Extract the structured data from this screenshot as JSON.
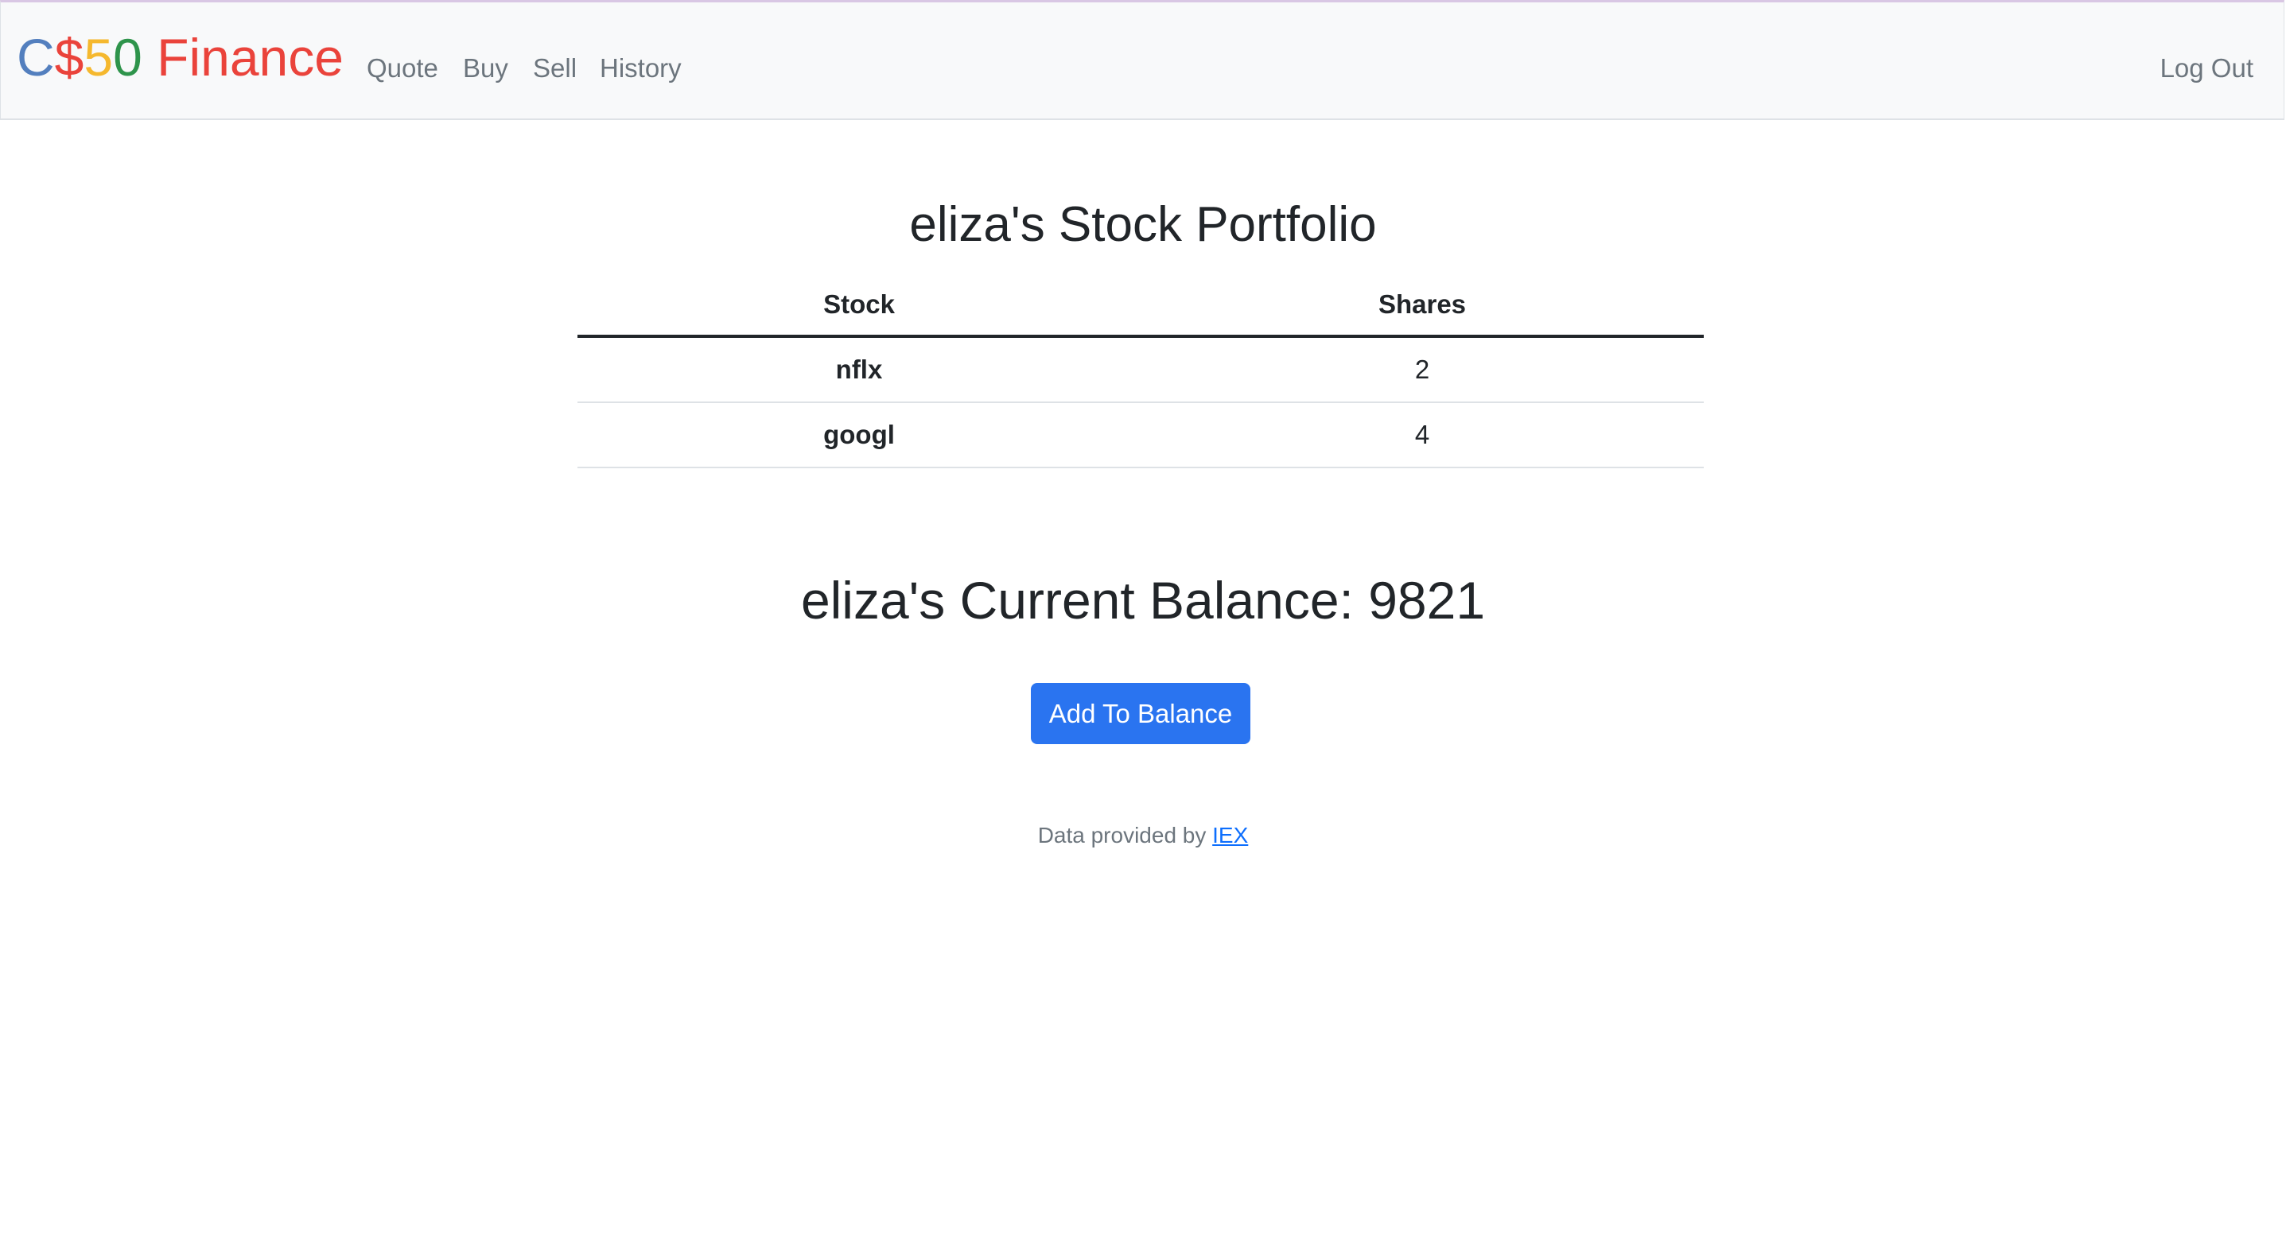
{
  "navbar": {
    "brand": {
      "part1": "C",
      "part2": "$",
      "part3": "5",
      "part4": "0",
      "part5": " Finance"
    },
    "links": {
      "quote": "Quote",
      "buy": "Buy",
      "sell": "Sell",
      "history": "History",
      "logout": "Log Out"
    }
  },
  "main": {
    "title": "eliza's Stock Portfolio",
    "table": {
      "headers": [
        "Stock",
        "Shares"
      ],
      "rows": [
        {
          "stock": "nflx",
          "shares": "2"
        },
        {
          "stock": "googl",
          "shares": "4"
        }
      ]
    },
    "balance_heading": "eliza's Current Balance: 9821",
    "add_balance_button": "Add To Balance"
  },
  "footer": {
    "prefix": "Data provided by ",
    "link": "IEX"
  },
  "colors": {
    "brand_blue": "#537fbe",
    "brand_red": "#ea433b",
    "brand_yellow": "#f5b82e",
    "brand_green": "#2e944b",
    "button_primary": "#2a74f0"
  }
}
